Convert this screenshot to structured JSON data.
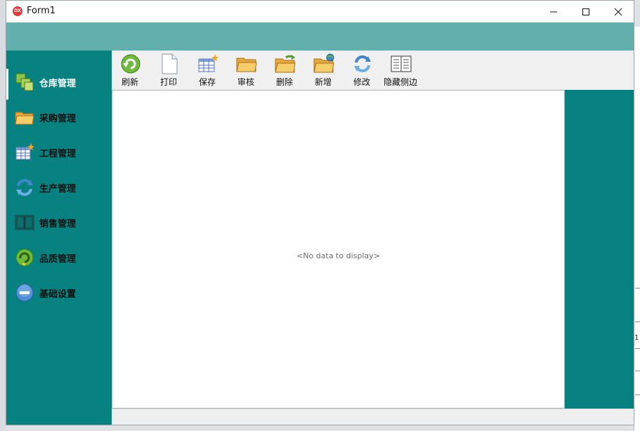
{
  "window": {
    "title": "Form1",
    "logo_text": "DX"
  },
  "background": {
    "fragment_number": "1"
  },
  "colors": {
    "teal_header": "#63afae",
    "sidebar": "#078280",
    "right_panel": "#078280",
    "active_text": "#ffffff"
  },
  "sidebar": {
    "items": [
      {
        "label": "仓库管理",
        "icon": "warehouse-cubes-icon",
        "active": true
      },
      {
        "label": "采购管理",
        "icon": "folder-icon",
        "active": false
      },
      {
        "label": "工程管理",
        "icon": "table-star-icon",
        "active": false
      },
      {
        "label": "生产管理",
        "icon": "refresh-arrows-icon",
        "active": false
      },
      {
        "label": "销售管理",
        "icon": "book-icon",
        "active": false
      },
      {
        "label": "品质管理",
        "icon": "green-refresh-icon",
        "active": false
      },
      {
        "label": "基础设置",
        "icon": "minus-circle-icon",
        "active": false
      }
    ]
  },
  "toolbar": {
    "buttons": [
      {
        "label": "刷新",
        "icon": "refresh-icon"
      },
      {
        "label": "打印",
        "icon": "document-icon"
      },
      {
        "label": "保存",
        "icon": "save-table-icon"
      },
      {
        "label": "审核",
        "icon": "folder-open-icon"
      },
      {
        "label": "删除",
        "icon": "folder-delete-icon"
      },
      {
        "label": "新增",
        "icon": "folder-add-icon"
      },
      {
        "label": "修改",
        "icon": "edit-refresh-icon"
      },
      {
        "label": "隐藏侧边",
        "icon": "book-icon"
      }
    ]
  },
  "grid": {
    "empty_text": "<No data to display>"
  }
}
